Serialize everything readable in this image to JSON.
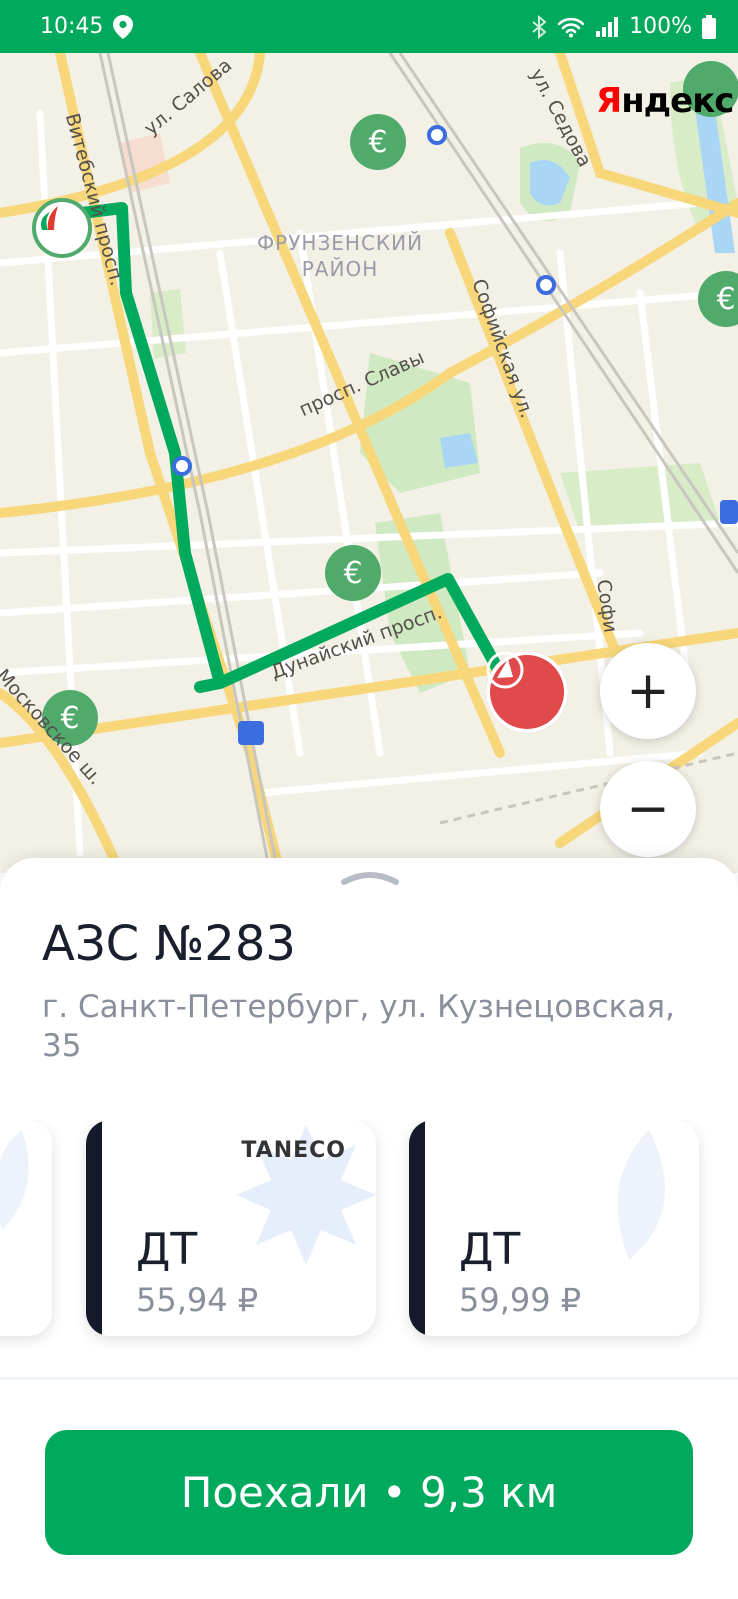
{
  "status_bar": {
    "time": "10:45",
    "battery": "100%"
  },
  "map": {
    "provider": "Яндекс",
    "district_line1": "ФРУНЗЕНСКИЙ",
    "district_line2": "РАЙОН",
    "streets": {
      "salova": "ул. Салова",
      "vitebsky": "Витебский просп.",
      "sedova": "ул. Седова",
      "slavy": "просп. Славы",
      "sofiyskaya": "Софийская ул.",
      "sofi_short": "Софи",
      "dunaysky": "Дунайский просп.",
      "moskovskoe": "Московское ш."
    },
    "zoom_in": "+",
    "zoom_out": "−"
  },
  "station": {
    "title": "АЗС №283",
    "address": "г. Санкт-Петербург, ул. Кузнецовская, 35"
  },
  "fuels": [
    {
      "name": "ДТ",
      "price": "55,94 ₽",
      "brand": "TANECO"
    },
    {
      "name": "ДТ",
      "price": "59,99 ₽",
      "brand": ""
    }
  ],
  "action": {
    "go_label": "Поехали • 9,3 км"
  },
  "colors": {
    "brand_green": "#00a95c",
    "route": "#00a95c",
    "destination": "#e04a4a"
  }
}
